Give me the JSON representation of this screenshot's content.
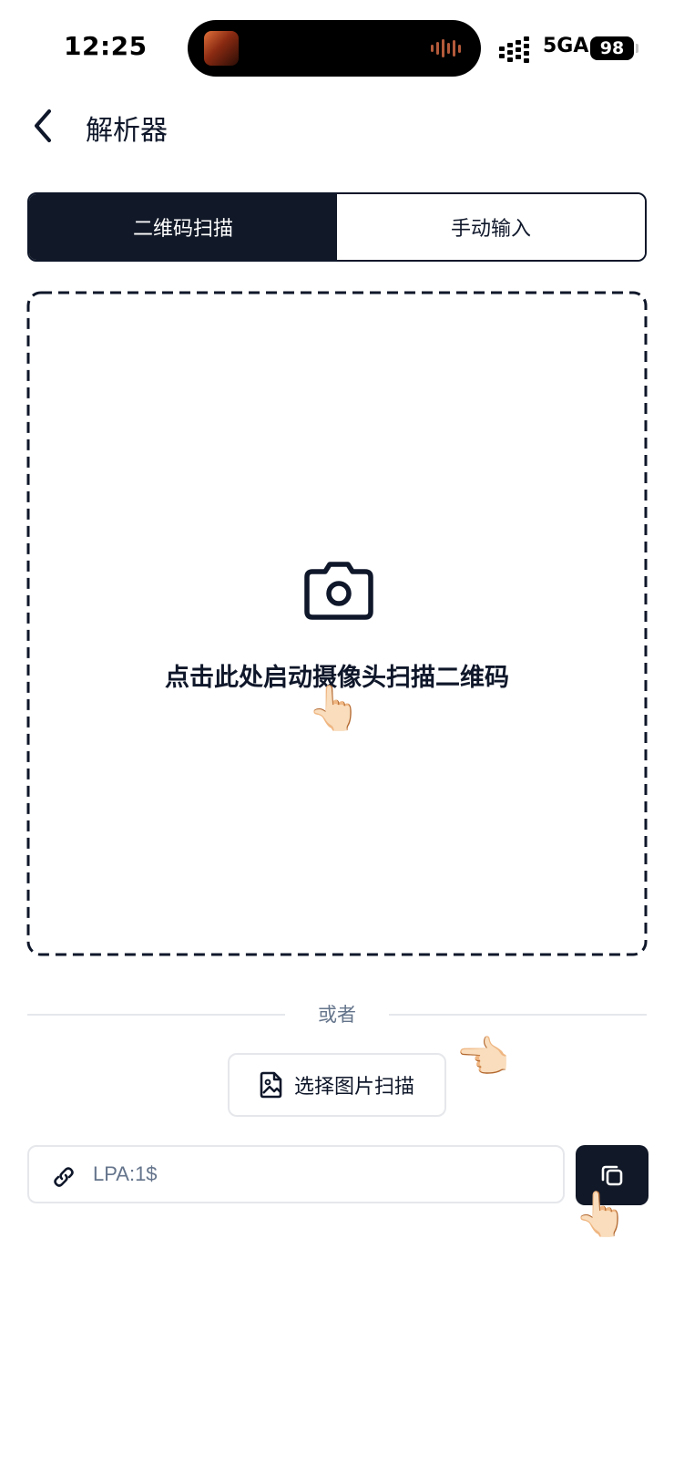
{
  "status_bar": {
    "time": "12:25",
    "network": "5GA",
    "battery": "98",
    "icons": [
      "now-playing-art",
      "audio-waveform-icon",
      "signal-icon",
      "battery-icon"
    ]
  },
  "header": {
    "title": "解析器",
    "back_icon": "chevron-left-icon"
  },
  "tabs": [
    {
      "label": "二维码扫描",
      "active": true
    },
    {
      "label": "手动输入",
      "active": false
    }
  ],
  "scan_area": {
    "icon": "camera-icon",
    "prompt": "点击此处启动摄像头扫描二维码",
    "pointer": "👆🏻"
  },
  "divider": {
    "label": "或者"
  },
  "image_scan": {
    "icon": "image-file-icon",
    "label": "选择图片扫描",
    "pointer": "👈🏻"
  },
  "lpa_input": {
    "icon": "link-icon",
    "value": "",
    "placeholder": "LPA:1$"
  },
  "copy_button": {
    "icon": "copy-icon",
    "pointer": "👆🏻"
  },
  "colors": {
    "primary_dark": "#111827",
    "border_light": "#e5e7eb",
    "muted_text": "#64748b"
  }
}
